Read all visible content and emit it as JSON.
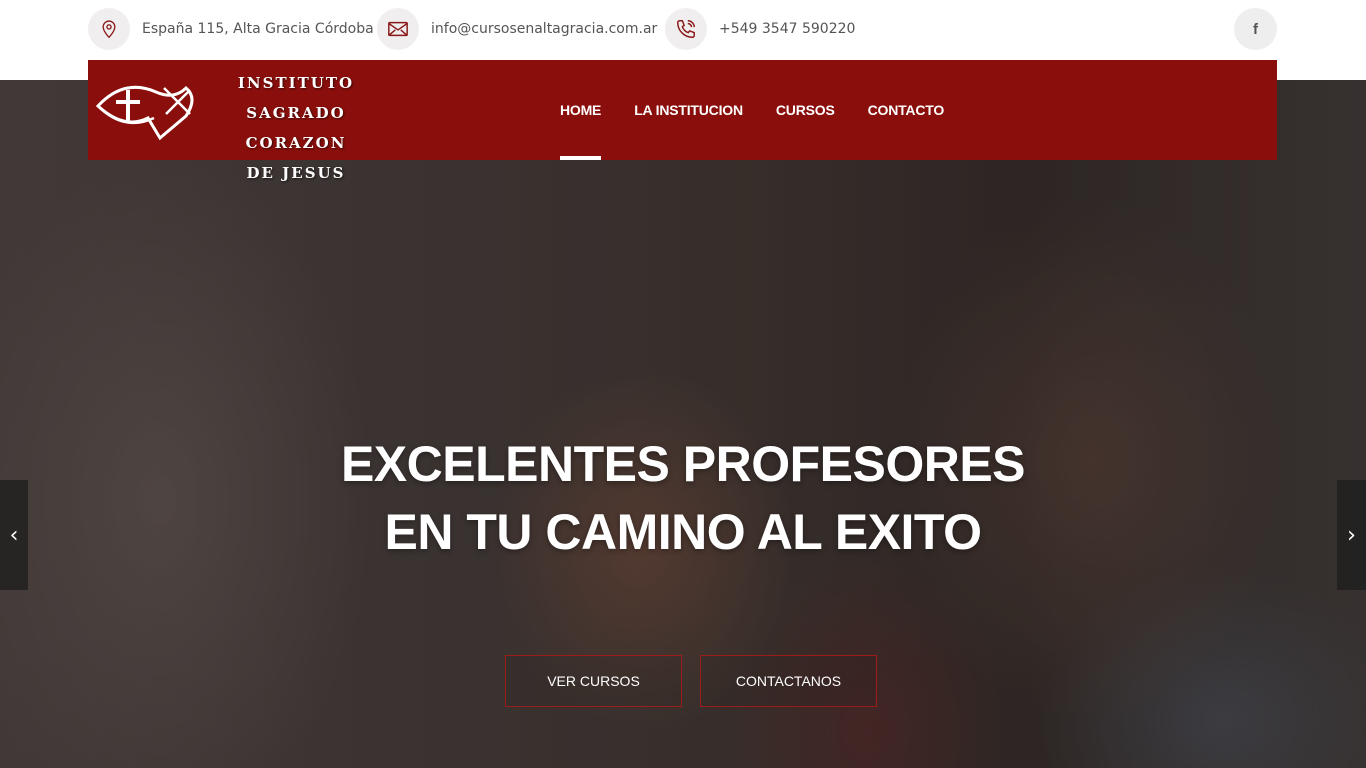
{
  "topbar": {
    "address": {
      "icon": "map-pin-icon",
      "text": "España 115, Alta Gracia Córdoba"
    },
    "email": {
      "icon": "envelope-icon",
      "text": "info@cursosenaltagracia.com.ar"
    },
    "phone": {
      "icon": "phone-icon",
      "text": "+549 3547 590220"
    },
    "social": {
      "icon": "facebook-icon",
      "label": "f"
    }
  },
  "brand": {
    "line1": "INSTITUTO",
    "line2": "SAGRADO CORAZON",
    "line3": "DE JESUS",
    "logo_icon": "cross-fish-heart-logo"
  },
  "nav": {
    "items": [
      {
        "label": "HOME",
        "active": true
      },
      {
        "label": "LA INSTITUCION",
        "active": false
      },
      {
        "label": "CURSOS",
        "active": false
      },
      {
        "label": "CONTACTO",
        "active": false
      }
    ]
  },
  "hero": {
    "headline_line1": "EXCELENTES PROFESORES",
    "headline_line2": "EN TU CAMINO AL EXITO",
    "button_primary": "VER CURSOS",
    "button_secondary": "CONTACTANOS",
    "prev_arrow": "‹",
    "next_arrow": "›"
  },
  "colors": {
    "brand_red": "#8a0f0c",
    "button_border": "#9c1b1b",
    "icon_red": "#8a1a1a"
  }
}
